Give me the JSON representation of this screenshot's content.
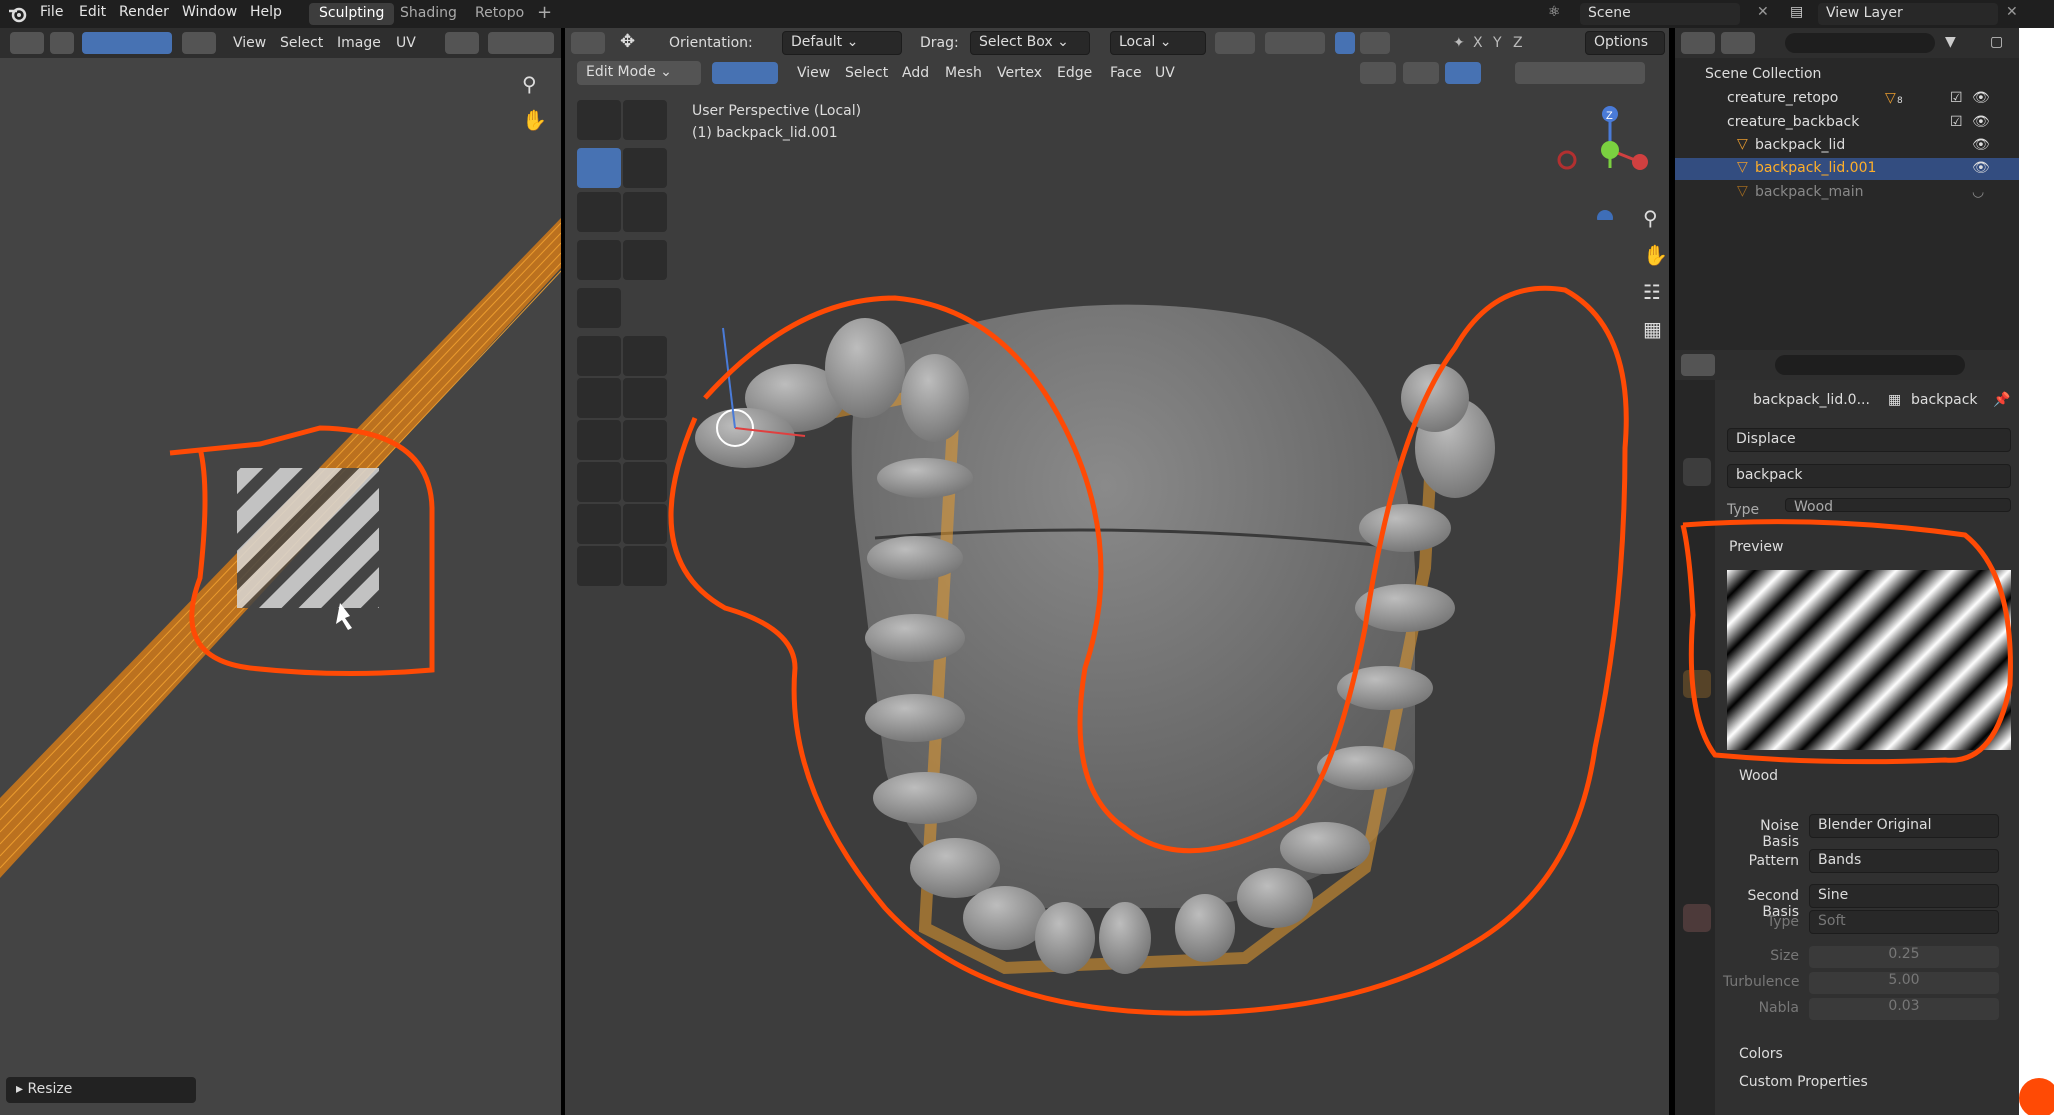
{
  "menu": {
    "file": "File",
    "edit": "Edit",
    "render": "Render",
    "window": "Window",
    "help": "Help"
  },
  "workspaces": [
    "Sculpting",
    "Shading",
    "Retopo"
  ],
  "scene": {
    "label": "Scene",
    "view_layer": "View Layer"
  },
  "uv_editor": {
    "menu": [
      "View",
      "Select",
      "Image",
      "UV"
    ],
    "operator": "Resize"
  },
  "viewport": {
    "orientation_label": "Orientation:",
    "orientation_value": "Default",
    "drag_label": "Drag:",
    "drag_value": "Select Box",
    "pivot": "Local",
    "axes": [
      "X",
      "Y",
      "Z"
    ],
    "options": "Options",
    "mode": "Edit Mode",
    "menu": [
      "View",
      "Select",
      "Add",
      "Mesh",
      "Vertex",
      "Edge",
      "Face",
      "UV"
    ],
    "info_line1": "User Perspective (Local)",
    "info_line2": "(1) backpack_lid.001",
    "gizmo_z": "Z"
  },
  "outliner": {
    "collection": "Scene Collection",
    "items": [
      {
        "name": "creature_retopo",
        "badge": "8"
      },
      {
        "name": "creature_backback"
      },
      {
        "name": "backpack_lid"
      },
      {
        "name": "backpack_lid.001"
      },
      {
        "name": "backpack_main"
      }
    ]
  },
  "properties": {
    "object": "backpack_lid.0...",
    "texture_ref": "backpack",
    "modifier": "Displace",
    "texture_name": "backpack",
    "type_label": "Type",
    "type_value": "Wood",
    "preview_header": "Preview",
    "wood_header": "Wood",
    "noise_basis_label": "Noise Basis",
    "noise_basis_value": "Blender Original",
    "pattern_label": "Pattern",
    "pattern_value": "Bands",
    "second_basis_label": "Second Basis",
    "second_basis_value": "Sine",
    "type2_label": "Type",
    "type2_value": "Soft",
    "size_label": "Size",
    "size_value": "0.25",
    "turbulence_label": "Turbulence",
    "turbulence_value": "5.00",
    "nabla_label": "Nabla",
    "nabla_value": "0.03",
    "colors_header": "Colors",
    "custom_header": "Custom Properties"
  },
  "colors": {
    "accent": "#4772b3",
    "annotation": "#ff4a05",
    "orange_mesh": "#e69a2e"
  }
}
